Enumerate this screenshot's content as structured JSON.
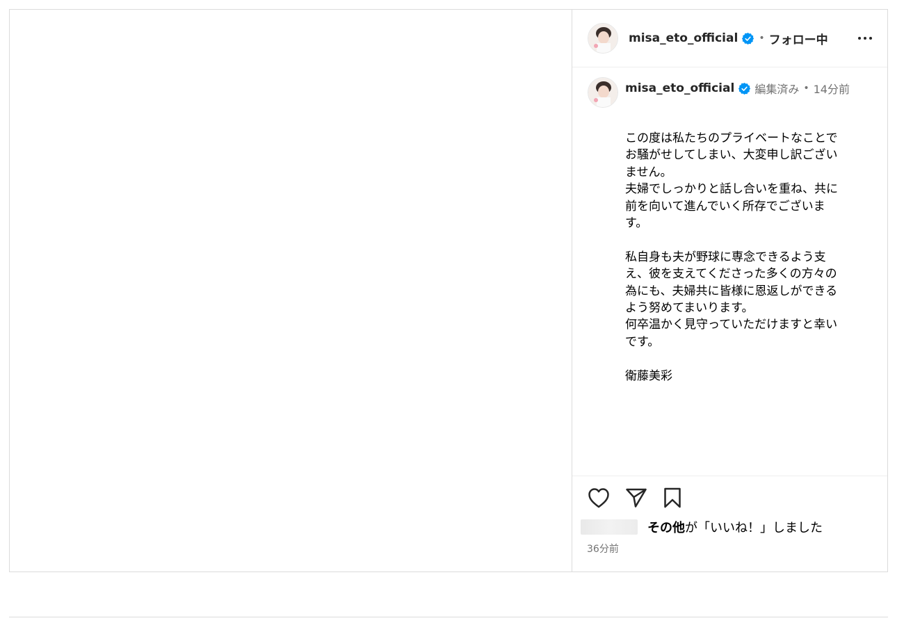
{
  "header": {
    "username": "misa_eto_official",
    "separator": "•",
    "follow_status": "フォロー中"
  },
  "caption": {
    "username": "misa_eto_official",
    "edited": "編集済み",
    "separator": "•",
    "time_ago": "14分前",
    "lines": [
      "この度は私たちのプライベートなことで",
      "お騒がせしてしまい、大変申し訳ござい",
      "ません。",
      "夫婦でしっかりと話し合いを重ね、共に",
      "前を向いて進んでいく所存でございま",
      "す。",
      "",
      "私自身も夫が野球に専念できるよう支",
      "え、彼を支えてくださった多くの方々の",
      "為にも、夫婦共に皆様に恩返しができる",
      "よう努めてまいります。",
      "何卒温かく見守っていただけますと幸い",
      "です。",
      "",
      "衛藤美彩"
    ]
  },
  "likes": {
    "others_label": "その他",
    "suffix": "が「いいね！」しました"
  },
  "post_time": "36分前",
  "icons": {
    "more": "more-options-icon",
    "like": "heart-icon",
    "share": "send-icon",
    "save": "bookmark-icon",
    "verified": "verified-badge-icon"
  },
  "colors": {
    "verified": "#0095f6",
    "border": "#dbdbdb",
    "secondary_text": "#737373"
  }
}
